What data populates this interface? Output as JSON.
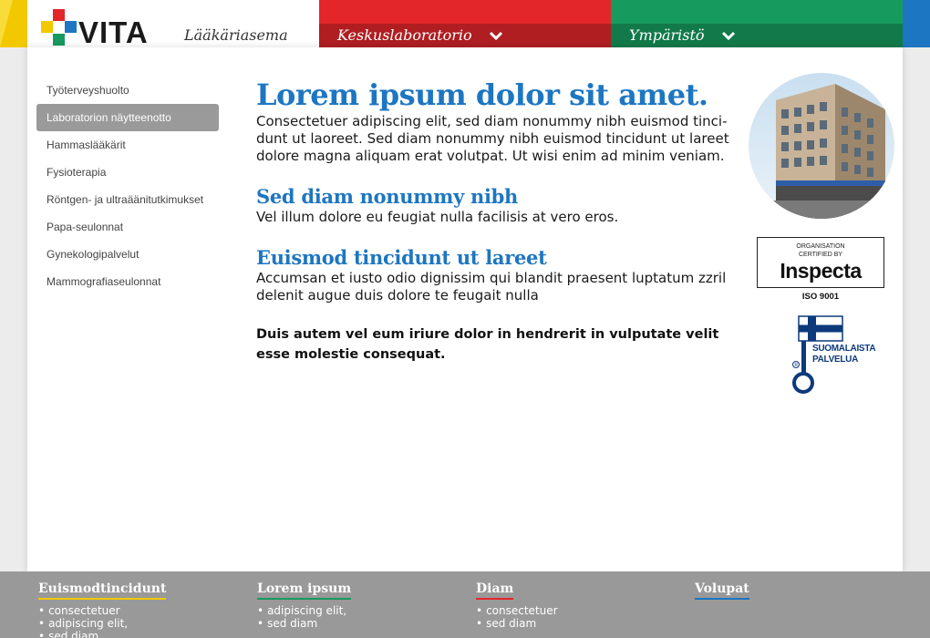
{
  "header": {
    "brand": "VITA",
    "subtitle": "Lääkäriasema",
    "menu1": "Keskuslaboratorio",
    "menu2": "Ympäristö",
    "colors": {
      "yellow": "#f2c800",
      "red": "#e2262a",
      "green": "#179a5e",
      "blue": "#1d76c2"
    }
  },
  "sidebar": {
    "items": [
      {
        "label": "Työterveyshuolto"
      },
      {
        "label": "Laboratorion näytteenotto",
        "active": true
      },
      {
        "label": "Hammaslääkärit"
      },
      {
        "label": "Fysioterapia"
      },
      {
        "label": "Röntgen- ja ultraäänitutkimukset"
      },
      {
        "label": "Papa-seulonnat"
      },
      {
        "label": "Gynekologipalvelut"
      },
      {
        "label": "Mammografiaseulonnat"
      }
    ]
  },
  "main": {
    "title": "Lorem ipsum dolor sit amet.",
    "intro": "Consectetuer adipiscing elit, sed diam nonummy nibh euismod tinci-dunt ut laoreet. Sed diam nonummy nibh euismod tincidunt ut lareet dolore magna aliquam erat volutpat. Ut wisi enim ad minim veniam.",
    "h2a": "Sed diam nonummy nibh",
    "p2": "Vel illum dolore eu feugiat nulla facilisis at vero eros.",
    "h2b": "Euismod tincidunt ut lareet",
    "p3": "Accumsan et iusto odio dignissim qui blandit praesent luptatum zzril delenit augue duis dolore te feugait nulla",
    "bold": "Duis autem vel eum iriure dolor in hendrerit in vulputate velit esse molestie consequat."
  },
  "certs": {
    "inspecta_small1": "ORGANISATION",
    "inspecta_small2": "CERTIFIED BY",
    "inspecta_name": "Inspecta",
    "iso": "ISO 9001",
    "key_line1": "SUOMALAISTA",
    "key_line2": "PALVELUA"
  },
  "footer": {
    "columns": [
      {
        "title": "Euismodtincidunt",
        "accent": "#f2c800",
        "items": [
          "consectetuer",
          "adipiscing elit,",
          "sed diam"
        ]
      },
      {
        "title": "Lorem ipsum",
        "accent": "#179a5e",
        "items": [
          "adipiscing elit,",
          "sed diam"
        ]
      },
      {
        "title": "Diam",
        "accent": "#e2262a",
        "items": [
          "consectetuer",
          "sed diam"
        ]
      },
      {
        "title": "Volupat",
        "accent": "#1d76c2",
        "items": []
      }
    ]
  }
}
